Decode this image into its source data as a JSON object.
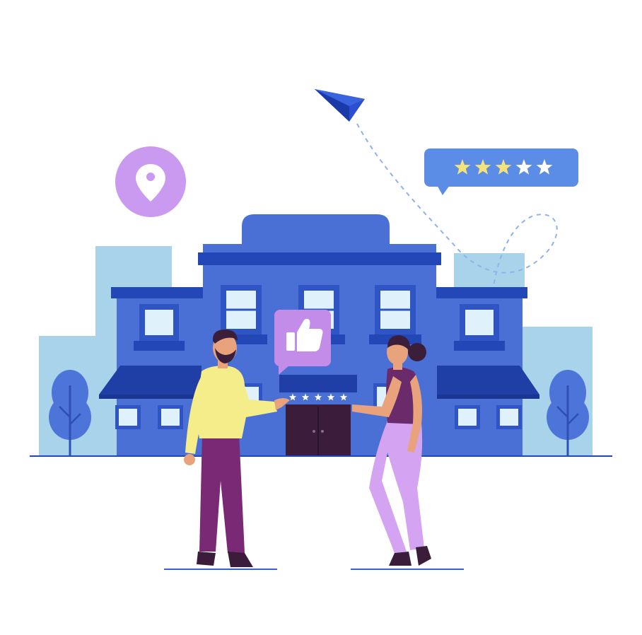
{
  "scene": {
    "colors": {
      "background": "#ffffff",
      "building_main": "#4a70d6",
      "building_dark": "#2447b8",
      "building_darker": "#1f3fa6",
      "building_light": "#5b82e0",
      "city_bg": "#a9d3ea",
      "window_frame": "#2f55c4",
      "window_glass": "#dff1fb",
      "door": "#3b1c3a",
      "location_pin_bg": "#c99af0",
      "thumbs_up_bg": "#c28ce8",
      "rating_bubble_bg": "#5b8de6",
      "star_filled": "#f4e27a",
      "star_empty": "#ffffff",
      "paper_plane": "#2a4fd1",
      "tree": "#4d74d9",
      "man_shirt": "#f5ec8a",
      "man_pants": "#7a2a74",
      "woman_shirt": "#6b2a6a",
      "woman_pants": "#d4a4f3",
      "hair": "#3b1f3a",
      "skin": "#e8a27c",
      "ground_line": "#2447b8"
    },
    "icons": {
      "location_pin": "location-pin-icon",
      "thumbs_up": "thumbs-up-icon",
      "paper_plane": "paper-plane-icon",
      "star": "star-icon"
    },
    "rating": {
      "stars_total": 5,
      "stars_filled": 3
    },
    "awning_rating": {
      "stars_total": 5
    }
  }
}
